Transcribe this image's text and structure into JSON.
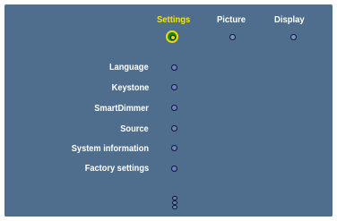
{
  "tabs": [
    {
      "label": "Settings",
      "active": true
    },
    {
      "label": "Picture",
      "active": false
    },
    {
      "label": "Display",
      "active": false
    }
  ],
  "menu": {
    "items": [
      {
        "label": "Language"
      },
      {
        "label": "Keystone"
      },
      {
        "label": "SmartDimmer"
      },
      {
        "label": "Source"
      },
      {
        "label": "System information"
      },
      {
        "label": "Factory settings"
      }
    ]
  },
  "colors": {
    "background": "#4f6e8e",
    "active_tab": "#f5e214",
    "text": "#ffffff",
    "active_indicator": "#1a8a1a"
  },
  "icons": {
    "active_tab_indicator": "selected-dot-icon",
    "inactive_tab_indicator": "dot-icon",
    "menu_bullet": "dot-icon",
    "more_below": "scroll-down-indicator-icon"
  }
}
